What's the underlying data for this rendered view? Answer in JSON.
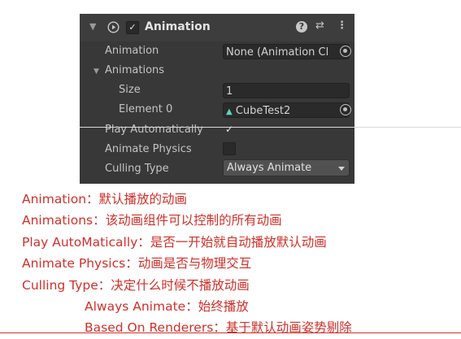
{
  "component": {
    "title": "Animation",
    "fold_glyph": "▼",
    "enabled_check": "✓",
    "icons": [
      "fold-arrow-icon",
      "animation-component-icon",
      "help-icon",
      "preset-icon",
      "kebab-menu-icon"
    ],
    "help_glyph": "?",
    "preset_glyph": "⇄",
    "menu_glyph": "⋮"
  },
  "properties": {
    "animation_label": "Animation",
    "animation_value": "None (Animation Cl",
    "animations_label": "Animations",
    "animations_fold": "▼",
    "size_label": "Size",
    "size_value": "1",
    "element0_label": "Element 0",
    "element0_value": "CubeTest2",
    "element0_icon": "▲",
    "play_auto_label": "Play Automatically",
    "play_auto_check": "✓",
    "play_auto_checked": true,
    "animate_physics_label": "Animate Physics",
    "animate_physics_checked": false,
    "culling_type_label": "Culling Type",
    "culling_type_value": "Always Animate"
  },
  "notes": [
    "Animation：默认播放的动画",
    "Animations：该动画组件可以控制的所有动画",
    "Play AutoMatically：是否一开始就自动播放默认动画",
    "Animate Physics：动画是否与物理交互",
    "Culling Type：决定什么时候不播放动画",
    "Always Animate：始终播放",
    "Based On Renderers：基于默认动画姿势剔除"
  ],
  "colors": {
    "panel_bg": "#383838",
    "field_bg": "#2a2a2a",
    "text": "#c4c4c4",
    "note_red": "#d0302a",
    "accent_cyan": "#5bd6c4"
  }
}
